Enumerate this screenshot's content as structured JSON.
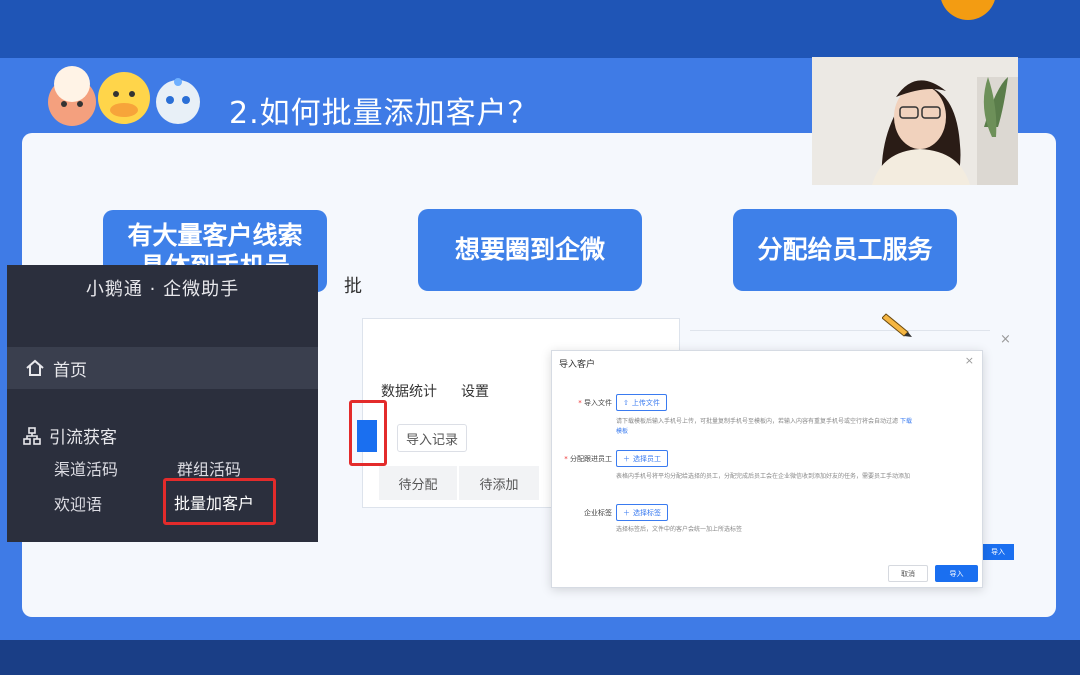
{
  "slide": {
    "title": "2.如何批量添加客户？",
    "pills": [
      {
        "line1": "有大量客户线索",
        "line2": "具体到手机号"
      },
      {
        "line1": "想要圈到企微",
        "line2": ""
      },
      {
        "line1": "分配给员工服务",
        "line2": ""
      }
    ]
  },
  "sidebar": {
    "brand": "小鹅通 · 企微助手",
    "home": "首页",
    "group": "引流获客",
    "items": [
      "渠道活码",
      "群组活码",
      "欢迎语",
      "批量加客户"
    ]
  },
  "panel": {
    "fragment": "批",
    "tabs": [
      "数据统计",
      "设置"
    ],
    "import_record": "导入记录",
    "segments": [
      "待分配",
      "待添加"
    ]
  },
  "dialog": {
    "title": "导入客户",
    "close": "×",
    "file_label": "导入文件",
    "upload_btn": "上传文件",
    "file_hint": "请下载模板后输入手机号上传，可批量复制手机号至模板内，若输入内容有重复手机号或空行将会自动过滤",
    "file_link": "下载模板",
    "staff_label": "分配跟进员工",
    "staff_btn": "选择员工",
    "staff_hint": "表格内手机号将平均分配给选择的员工，分配完成后员工会在企业微信收到添加好友的任务，需要员工手动添加",
    "tag_label": "企业标签",
    "tag_btn": "选择标签",
    "tag_hint": "选择标签后，文件中的客户会统一加上所选标签",
    "cancel": "取消",
    "ok": "导入"
  },
  "ghost": {
    "import": "导入",
    "close": "×"
  },
  "colors": {
    "accent": "#3e80e9",
    "highlight": "#e32b2b",
    "primary_btn": "#1a6ff0",
    "sidebar_bg": "#2b2f3d"
  },
  "icons": {
    "home": "home-icon",
    "group": "org-chart-icon",
    "upload": "upload-icon",
    "plus": "plus-icon",
    "pencil": "pencil-icon"
  }
}
